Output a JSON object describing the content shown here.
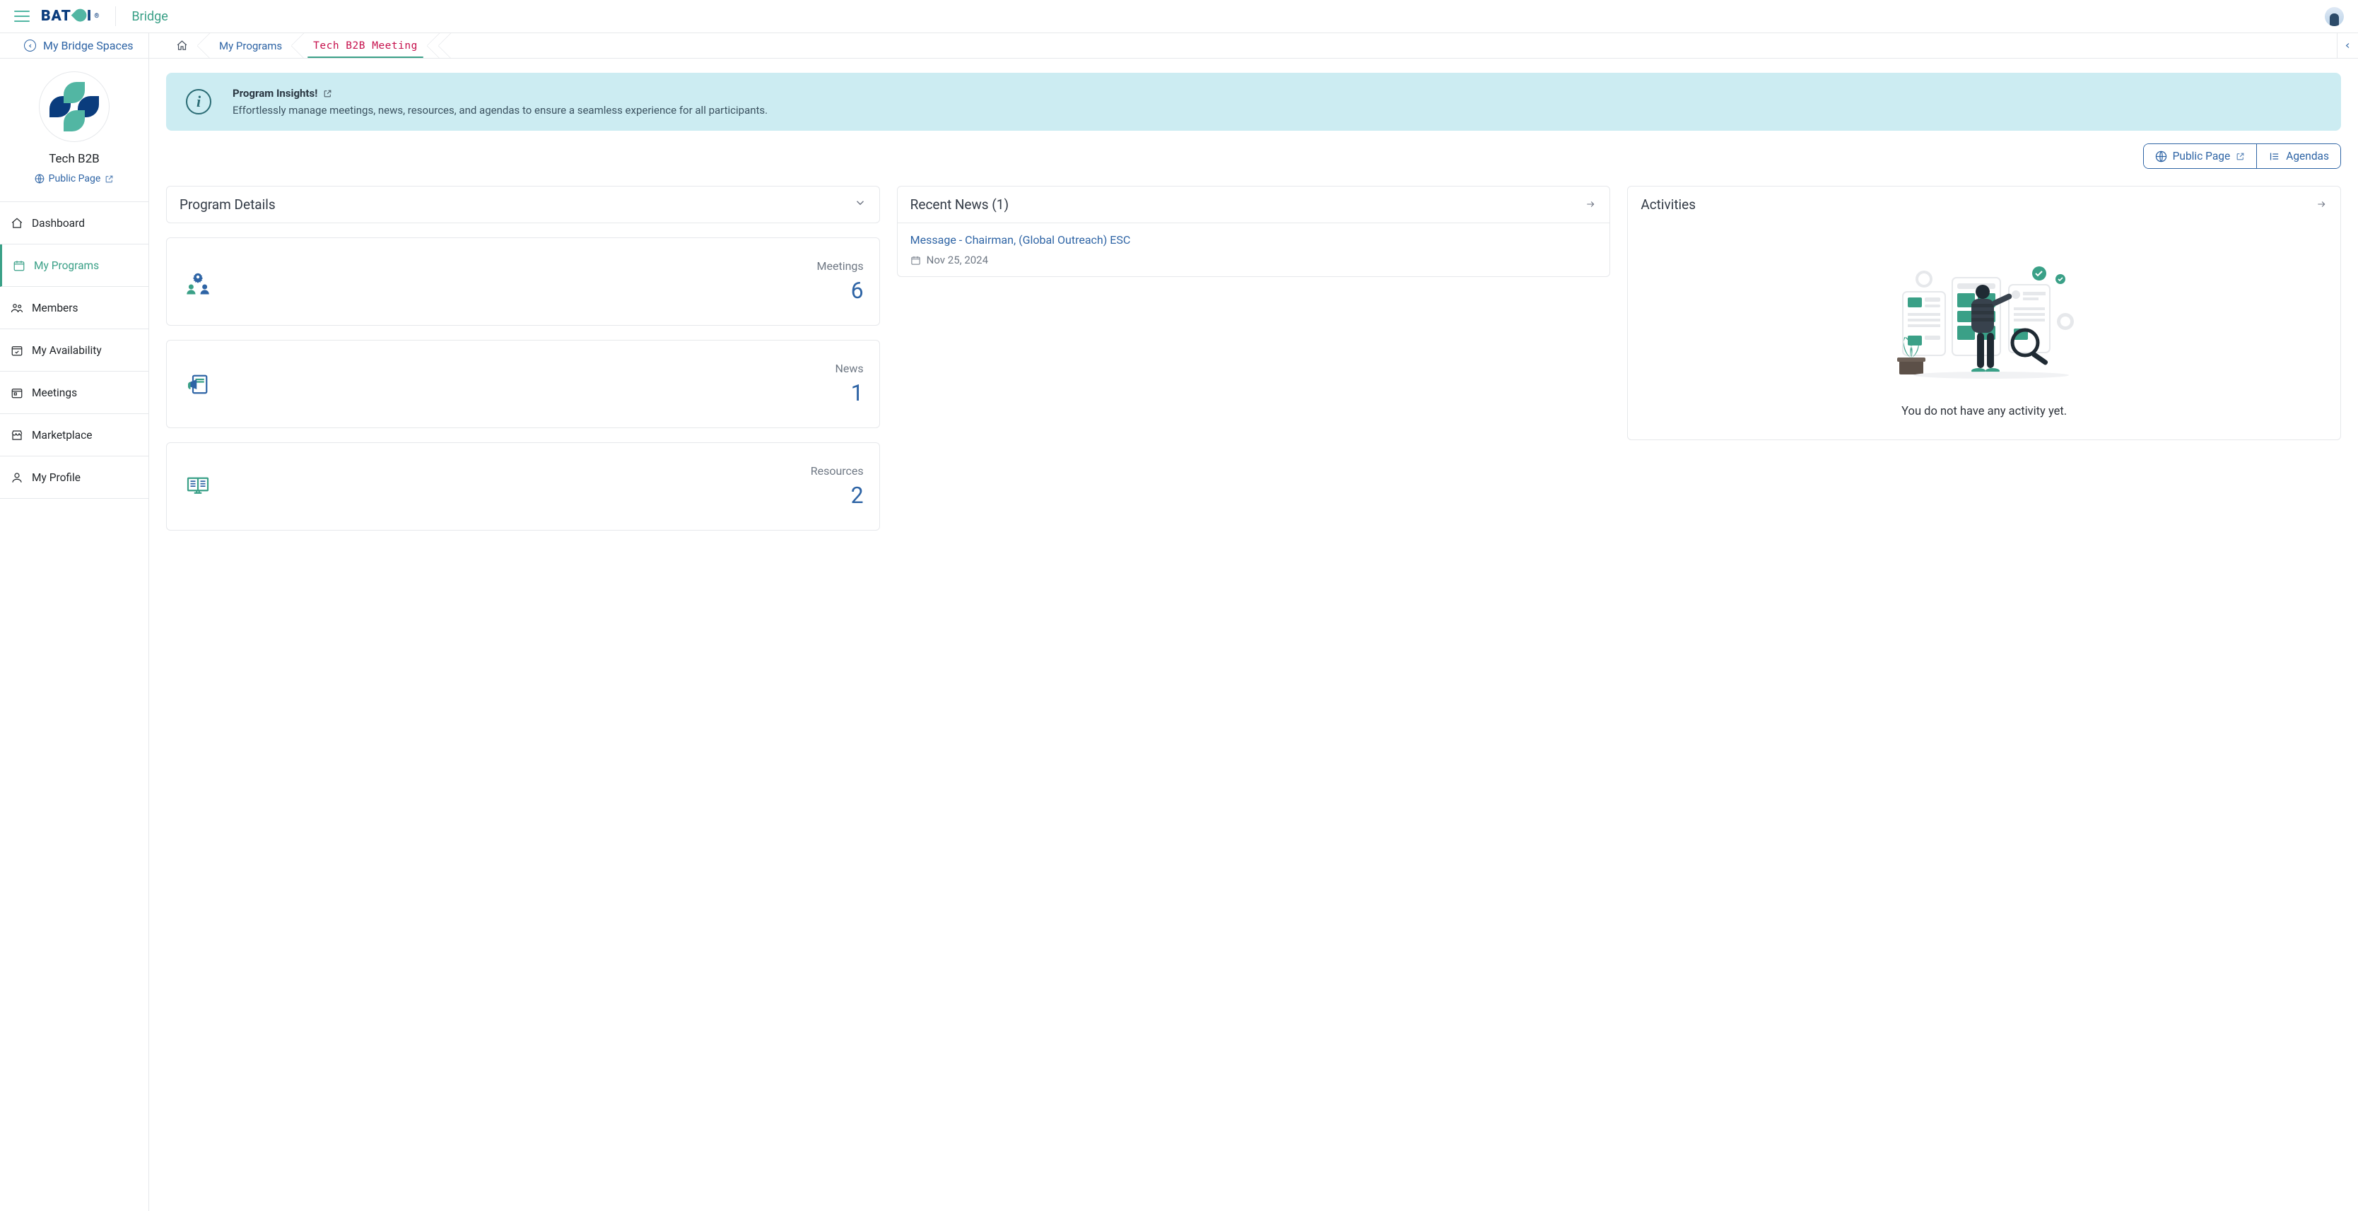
{
  "header": {
    "app_name_label": "Bridge",
    "logo_text": "BAT",
    "logo_text2": "I",
    "logo_reg": "®"
  },
  "breadcrumbs": {
    "left_label": "My Bridge Spaces",
    "items": [
      {
        "label": "My Programs"
      },
      {
        "label": "Tech B2B Meeting",
        "active": true
      }
    ]
  },
  "sidebar": {
    "org_name": "Tech B2B",
    "public_page_label": "Public Page",
    "nav": [
      {
        "label": "Dashboard",
        "icon": "home-icon"
      },
      {
        "label": "My Programs",
        "icon": "calendar-icon",
        "active": true
      },
      {
        "label": "Members",
        "icon": "users-icon"
      },
      {
        "label": "My Availability",
        "icon": "calendar-check-icon"
      },
      {
        "label": "Meetings",
        "icon": "calendar-date-icon"
      },
      {
        "label": "Marketplace",
        "icon": "store-icon"
      },
      {
        "label": "My Profile",
        "icon": "user-icon"
      }
    ]
  },
  "alert": {
    "title": "Program Insights!",
    "desc": "Effortlessly manage meetings, news, resources, and agendas to ensure a seamless experience for all participants."
  },
  "actions": {
    "public_page_label": "Public Page",
    "agendas_label": "Agendas"
  },
  "program_details": {
    "title": "Program Details",
    "stats": [
      {
        "key": "meetings",
        "label": "Meetings",
        "value": "6",
        "icon": "gear-users-icon"
      },
      {
        "key": "news",
        "label": "News",
        "value": "1",
        "icon": "megaphone-icon"
      },
      {
        "key": "resources",
        "label": "Resources",
        "value": "2",
        "icon": "book-icon"
      }
    ]
  },
  "recent_news": {
    "title": "Recent News (1)",
    "items": [
      {
        "headline": "Message - Chairman, (Global Outreach) ESC",
        "date": "Nov 25, 2024"
      }
    ]
  },
  "activities": {
    "title": "Activities",
    "empty_caption": "You do not have any activity yet."
  }
}
